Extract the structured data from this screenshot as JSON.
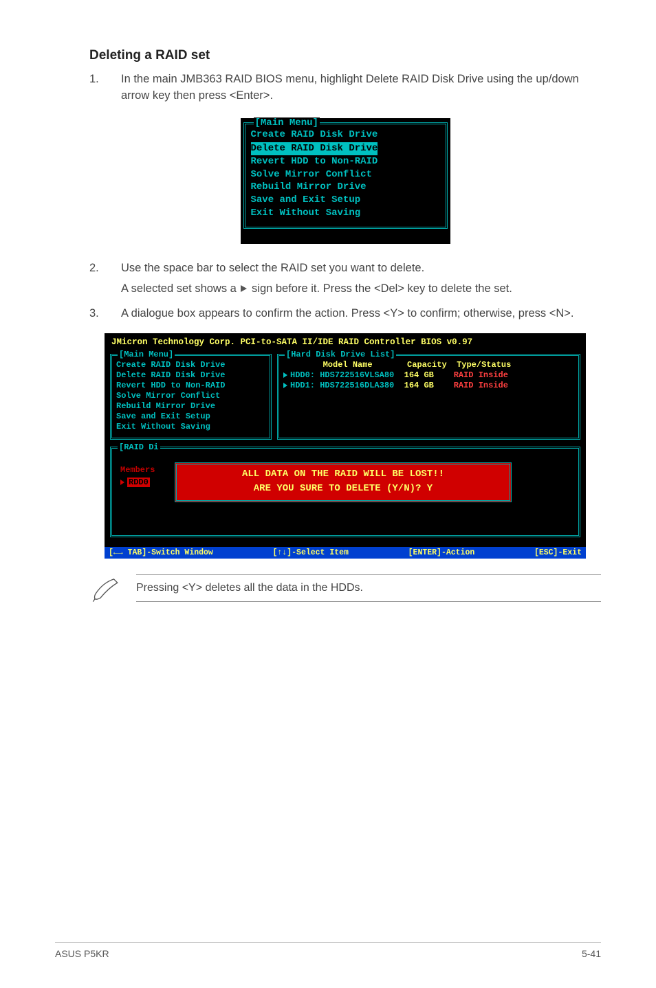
{
  "heading": "Deleting a RAID set",
  "steps": [
    {
      "num": "1.",
      "text": "In the main JMB363 RAID BIOS menu, highlight Delete RAID Disk Drive using the up/down arrow key then press <Enter>."
    },
    {
      "num": "2.",
      "text": "Use the space bar to select the RAID set you want to delete.",
      "para2_a": "A selected set shows a ",
      "para2_b": " sign before it. Press the <Del> key to delete the set."
    },
    {
      "num": "3.",
      "text": "A dialogue box appears to confirm the action. Press <Y> to confirm; otherwise, press <N>."
    }
  ],
  "mainMenu": {
    "title": "[Main Menu]",
    "items": [
      "Create RAID Disk Drive",
      "Delete RAID Disk Drive",
      "Revert HDD to Non-RAID",
      "Solve Mirror Conflict",
      "Rebuild Mirror Drive",
      "Save and Exit Setup",
      "Exit Without Saving"
    ],
    "selectedIndex": 1
  },
  "biosLarge": {
    "header": "JMicron Technology Corp. PCI-to-SATA II/IDE RAID Controller BIOS v0.97",
    "hddList": {
      "title": "[Hard Disk Drive List]",
      "head": {
        "model": "Model Name",
        "cap": "Capacity",
        "ts": "Type/Status"
      },
      "rows": [
        {
          "id": "HDD0:",
          "model": "HDS722516VLSA80",
          "cap": "164 GB",
          "ts": "RAID Inside"
        },
        {
          "id": "HDD1:",
          "model": "HDS722516DLA380",
          "cap": "164 GB",
          "ts": "RAID Inside"
        }
      ]
    },
    "raidPanel": {
      "title": "[RAID Di",
      "members": "Members",
      "row": "RDD0"
    },
    "alert": {
      "l1": "ALL DATA ON THE RAID WILL BE LOST!!",
      "l2": "ARE YOU SURE TO DELETE (Y/N)? Y"
    },
    "status": {
      "a": "TAB]-Switch Window",
      "b": "[↑↓]-Select Item",
      "c": "[ENTER]-Action",
      "d": "[ESC]-Exit"
    }
  },
  "note": "Pressing <Y> deletes all the data in the HDDs.",
  "footer": {
    "left": "ASUS P5KR",
    "right": "5-41"
  }
}
